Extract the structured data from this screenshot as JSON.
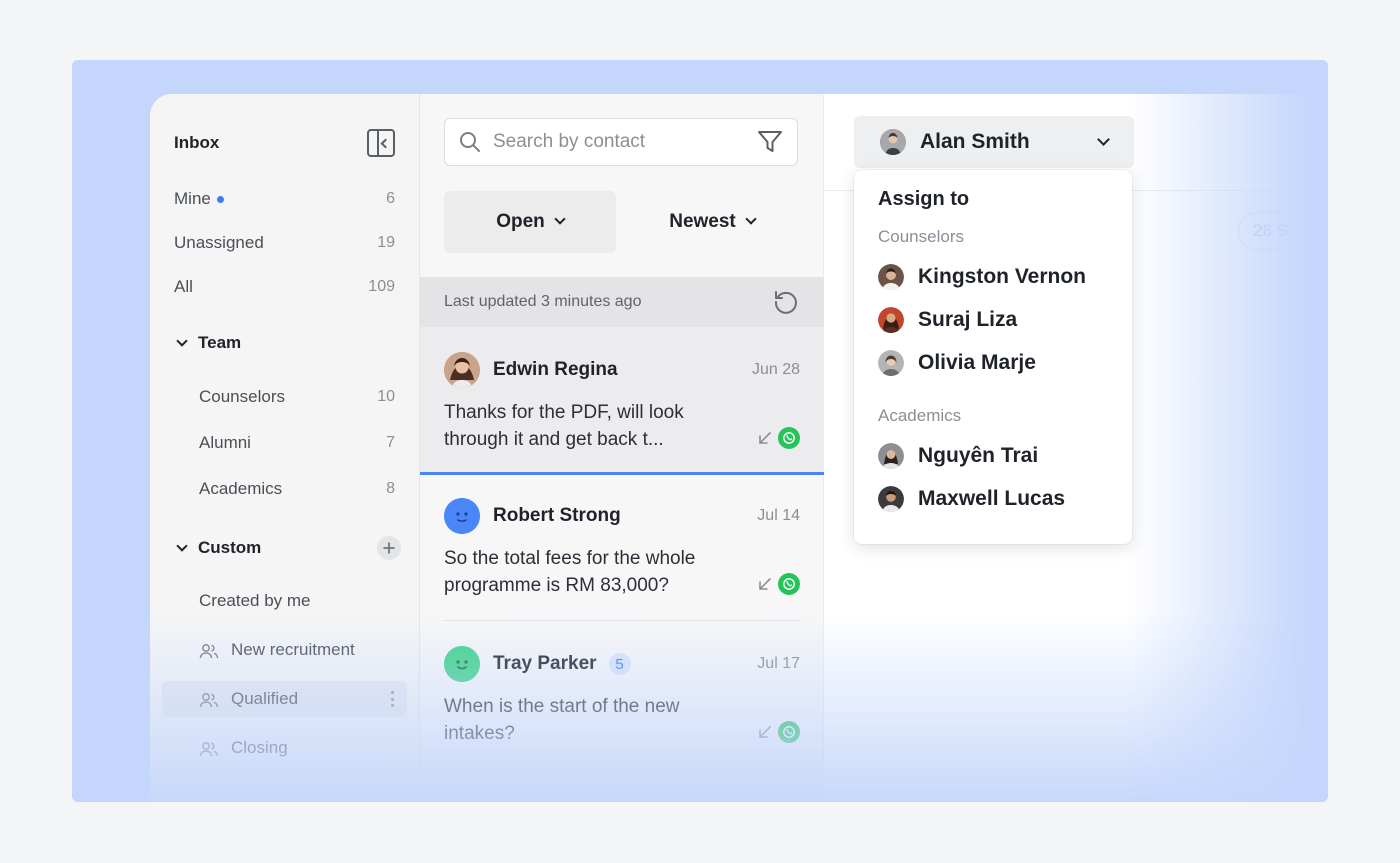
{
  "sidebar": {
    "title": "Inbox",
    "rows": [
      {
        "label": "Mine",
        "count": "6"
      },
      {
        "label": "Unassigned",
        "count": "19"
      },
      {
        "label": "All",
        "count": "109"
      }
    ],
    "team": {
      "label": "Team",
      "items": [
        {
          "label": "Counselors",
          "count": "10"
        },
        {
          "label": "Alumni",
          "count": "7"
        },
        {
          "label": "Academics",
          "count": "8"
        }
      ]
    },
    "custom": {
      "label": "Custom",
      "items": [
        {
          "label": "Created by me"
        },
        {
          "label": "New recruitment"
        },
        {
          "label": "Qualified"
        },
        {
          "label": "Closing"
        }
      ]
    }
  },
  "list": {
    "search_placeholder": "Search by contact",
    "status_filter": "Open",
    "sort": "Newest",
    "updated": "Last updated 3 minutes ago",
    "conversations": [
      {
        "name": "Edwin Regina",
        "date": "Jun 28",
        "message": "Thanks for the PDF, will look through it and get back t...",
        "channel": "whatsapp"
      },
      {
        "name": "Robert Strong",
        "date": "Jul 14",
        "message": "So the total fees for the whole programme is RM 83,000?",
        "channel": "whatsapp"
      },
      {
        "name": "Tray Parker",
        "badge": "5",
        "date": "Jul 17",
        "message": "When is the start of the new intakes?",
        "channel": "whatsapp"
      }
    ]
  },
  "assign": {
    "current": "Alan Smith",
    "title": "Assign to",
    "groups": [
      {
        "label": "Counselors",
        "people": [
          "Kingston Vernon",
          "Suraj Liza",
          "Olivia Marje"
        ]
      },
      {
        "label": "Academics",
        "people": [
          "Nguyên Trai",
          "Maxwell Lucas"
        ]
      }
    ],
    "partial_pill": "28 S"
  },
  "colors": {
    "accent": "#3b7bf6",
    "whatsapp": "#25c35a",
    "backdrop": "#c4d6fb"
  }
}
